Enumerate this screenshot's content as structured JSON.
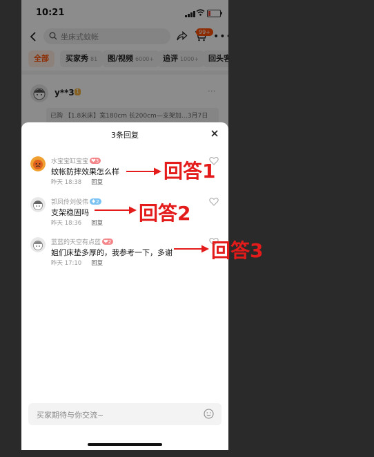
{
  "status_bar": {
    "time": "10:21"
  },
  "search": {
    "placeholder": "坐床式蚊帐"
  },
  "cart_badge": "99+",
  "tabs": [
    {
      "label": "全部",
      "count": ""
    },
    {
      "label": "买家秀",
      "count": "81"
    },
    {
      "label": "图/视频",
      "count": "6000+"
    },
    {
      "label": "追评",
      "count": "1000+"
    },
    {
      "label": "回头客",
      "count": ""
    }
  ],
  "review": {
    "user": "y**3",
    "vip": "1",
    "info": "已购 【1.8米床】宽180cm 长200cm—支架加…3月7日"
  },
  "sheet": {
    "title": "3条回复"
  },
  "replies": [
    {
      "name": "水宝宝缸宝宝",
      "level": "3",
      "text": "蚊帐防摔效果怎么样",
      "time": "昨天 18:38",
      "reply_label": "回复"
    },
    {
      "name": "郭凤伶刘俊伟",
      "level": "2",
      "text": "支架稳固吗",
      "time": "昨天 18:36",
      "reply_label": "回复"
    },
    {
      "name": "蓝蓝的天空有点蓝",
      "level": "2",
      "text": "姐们床垫多厚的，我参考一下，多谢",
      "time": "昨天 17:10",
      "reply_label": "回复"
    }
  ],
  "input": {
    "placeholder": "买家期待与你交流~"
  },
  "annotations": [
    "回答1",
    "回答2",
    "回答3"
  ],
  "colors": {
    "accent": "#ff5000",
    "annotation": "#e31b1b",
    "level_red": "#f4868a",
    "level_blue": "#7bc3f2"
  }
}
